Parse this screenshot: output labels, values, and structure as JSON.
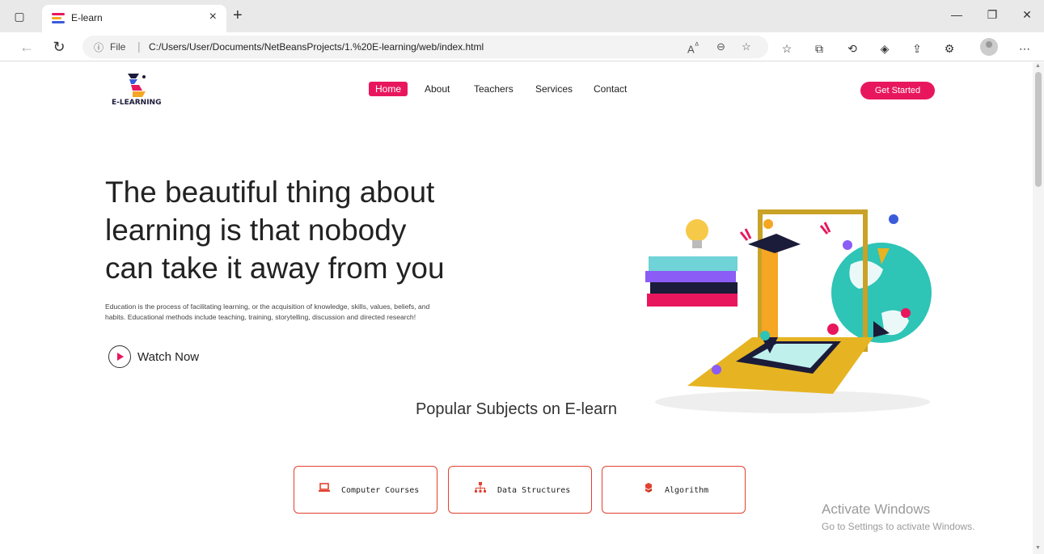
{
  "browser": {
    "tab_title": "E-learn",
    "address_file_label": "File",
    "address_url": "C:/Users/User/Documents/NetBeansProjects/1.%20E-learning/web/index.html"
  },
  "site": {
    "logo_text": "E-LEARNING",
    "nav": [
      "Home",
      "About",
      "Teachers",
      "Services",
      "Contact"
    ],
    "cta_label": "Get Started",
    "accent_color": "#e8175d"
  },
  "hero": {
    "title_lines": [
      "The beautiful thing about",
      "learning is that nobody",
      "can take it away from you"
    ],
    "description": "Education is the process of facilitating learning, or the acquisition of knowledge, skills, values, beliefs, and habits. Educational methods include teaching, training, storytelling, discussion and directed research!",
    "watch_label": "Watch Now"
  },
  "subjects": {
    "heading": "Popular Subjects on E-learn",
    "items": [
      {
        "label": "Computer Courses",
        "icon": "laptop-icon"
      },
      {
        "label": "Data Structures",
        "icon": "sitemap-icon"
      },
      {
        "label": "Algorithm",
        "icon": "cubes-icon"
      }
    ]
  },
  "watermark": {
    "line1": "Activate Windows",
    "line2": "Go to Settings to activate Windows."
  }
}
